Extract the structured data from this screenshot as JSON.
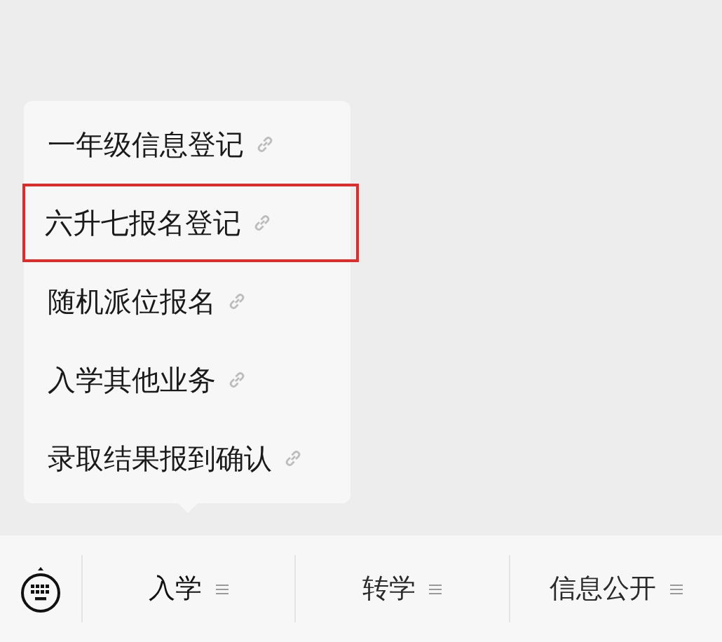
{
  "submenu": {
    "items": [
      {
        "label": "一年级信息登记",
        "highlighted": false
      },
      {
        "label": "六升七报名登记",
        "highlighted": true
      },
      {
        "label": "随机派位报名",
        "highlighted": false
      },
      {
        "label": "入学其他业务",
        "highlighted": false
      },
      {
        "label": "录取结果报到确认",
        "highlighted": false
      }
    ]
  },
  "menu_bar": {
    "items": [
      {
        "label": "入学",
        "selected": true
      },
      {
        "label": "转学",
        "selected": false
      },
      {
        "label": "信息公开",
        "selected": false
      }
    ]
  }
}
